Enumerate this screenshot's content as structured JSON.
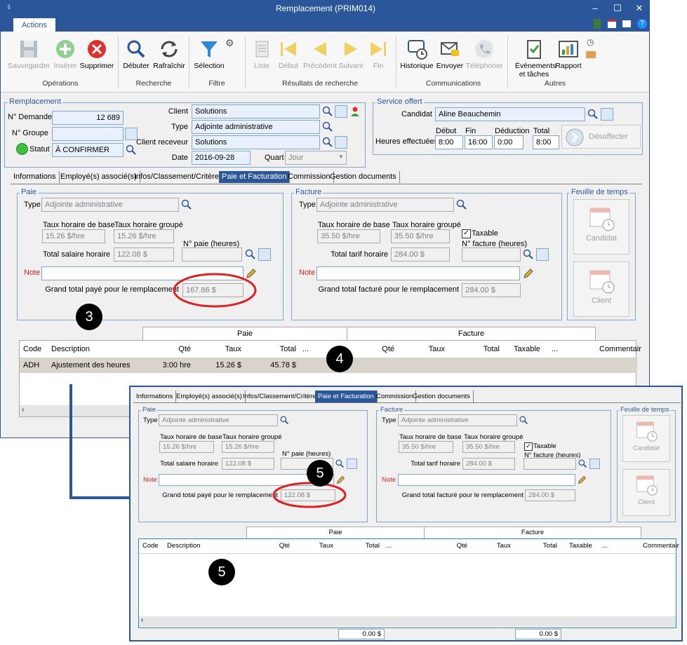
{
  "window": {
    "title": "Remplacement (PRIM014)",
    "minimize": "–",
    "maximize": "☐",
    "close": "✕"
  },
  "ribbon": {
    "tab": "Actions",
    "buttons": {
      "sauvegarder": "Sauvegarder",
      "inserer": "Insérer",
      "supprimer": "Supprimer",
      "debuter": "Débuter",
      "rafraichir": "Rafraîchir",
      "selection": "Sélection",
      "liste": "Liste",
      "debut": "Début",
      "precedent": "Précédent",
      "suivant": "Suivant",
      "fin": "Fin",
      "historique": "Historique",
      "envoyer": "Envoyer",
      "telephoner": "Téléphoner",
      "evenements1": "Évènements",
      "evenements2": "et tâches",
      "rapport": "Rapport"
    },
    "groups": {
      "operations": "Opérations",
      "recherche": "Recherche",
      "filtre": "Filtre",
      "resultats": "Résultats de recherche",
      "communications": "Communications",
      "autres": "Autres"
    }
  },
  "remplacement": {
    "legend": "Remplacement",
    "demande_label": "N° Demande",
    "demande_value": "12 689",
    "groupe_label": "N° Groupe",
    "groupe_value": "",
    "statut_label": "Statut",
    "statut_value": "À CONFIRMER",
    "client_label": "Client",
    "client_value": "Solutions",
    "type_label": "Type",
    "type_value": "Adjointe administrative",
    "client_receveur_label": "Client receveur",
    "client_receveur_value": "Solutions",
    "date_label": "Date",
    "date_value": "2016-09-28",
    "quart_label": "Quart",
    "quart_value": "Jour"
  },
  "service": {
    "legend": "Service offert",
    "candidat_label": "Candidat",
    "candidat_value": "Aline Beauchemin",
    "heures_label": "Heures effectuées",
    "debut_label": "Début",
    "debut_value": "8:00",
    "fin_label": "Fin",
    "fin_value": "16:00",
    "deduction_label": "Déduction",
    "deduction_value": "0:00",
    "total_label": "Total",
    "total_value": "8:00",
    "desaffecter": "Désaffecter"
  },
  "tabs": [
    "Informations",
    "Employé(s) associé(s)",
    "Infos/Classement/Critères",
    "Paie et Facturation",
    "Commission",
    "Gestion documents"
  ],
  "paie": {
    "legend": "Paie",
    "type_label": "Type",
    "type_value": "Adjointe administrative",
    "taux_base_label": "Taux horaire de base",
    "taux_base_value": "15.26 $/hre",
    "taux_groupe_label": "Taux horaire groupé",
    "taux_groupe_value": "15.26 $/hre",
    "npaie_label": "N° paie (heures)",
    "total_salaire_label": "Total salaire horaire",
    "total_salaire_value": "122.08 $",
    "note_label": "Note",
    "grand_total_label": "Grand total payé pour le remplacement",
    "grand_total_value": "167.86 $"
  },
  "facture": {
    "legend": "Facture",
    "type_label": "Type",
    "type_value": "Adjointe administrative",
    "taux_base_label": "Taux horaire de base",
    "taux_base_value": "35.50 $/hre",
    "taux_groupe_label": "Taux horaire groupé",
    "taux_groupe_value": "35.50 $/hre",
    "taxable_label": "Taxable",
    "nfacture_label": "N° facture (heures)",
    "total_tarif_label": "Total tarif horaire",
    "total_tarif_value": "284.00 $",
    "note_label": "Note",
    "grand_total_label": "Grand total facturé pour le remplacement",
    "grand_total_value": "284.00 $"
  },
  "feuille": {
    "legend": "Feuille de temps",
    "candidat": "Candidat",
    "client": "Client"
  },
  "grid": {
    "group_paie": "Paie",
    "group_facture": "Facture",
    "headers": {
      "code": "Code",
      "description": "Description",
      "qte": "Qté",
      "taux": "Taux",
      "total": "Total",
      "more": "...",
      "taxable": "Taxable",
      "commentaire": "Commentair"
    },
    "row": {
      "code": "ADH",
      "description": "Ajustement des heures",
      "qte": "3:00 hre",
      "taux": "15.26 $",
      "total": "45.78 $"
    }
  },
  "overlay": {
    "paie_grand_total_value": "122.08 $",
    "footer_paie_total": "0.00 $",
    "footer_facture_total": "0.00 $"
  },
  "callouts": {
    "c3": "3",
    "c4": "4",
    "c5a": "5",
    "c5b": "5"
  },
  "colors": {
    "titlebar": "#2b579a",
    "highlight": "#e02020",
    "selected_row": "#d8d4cc"
  }
}
